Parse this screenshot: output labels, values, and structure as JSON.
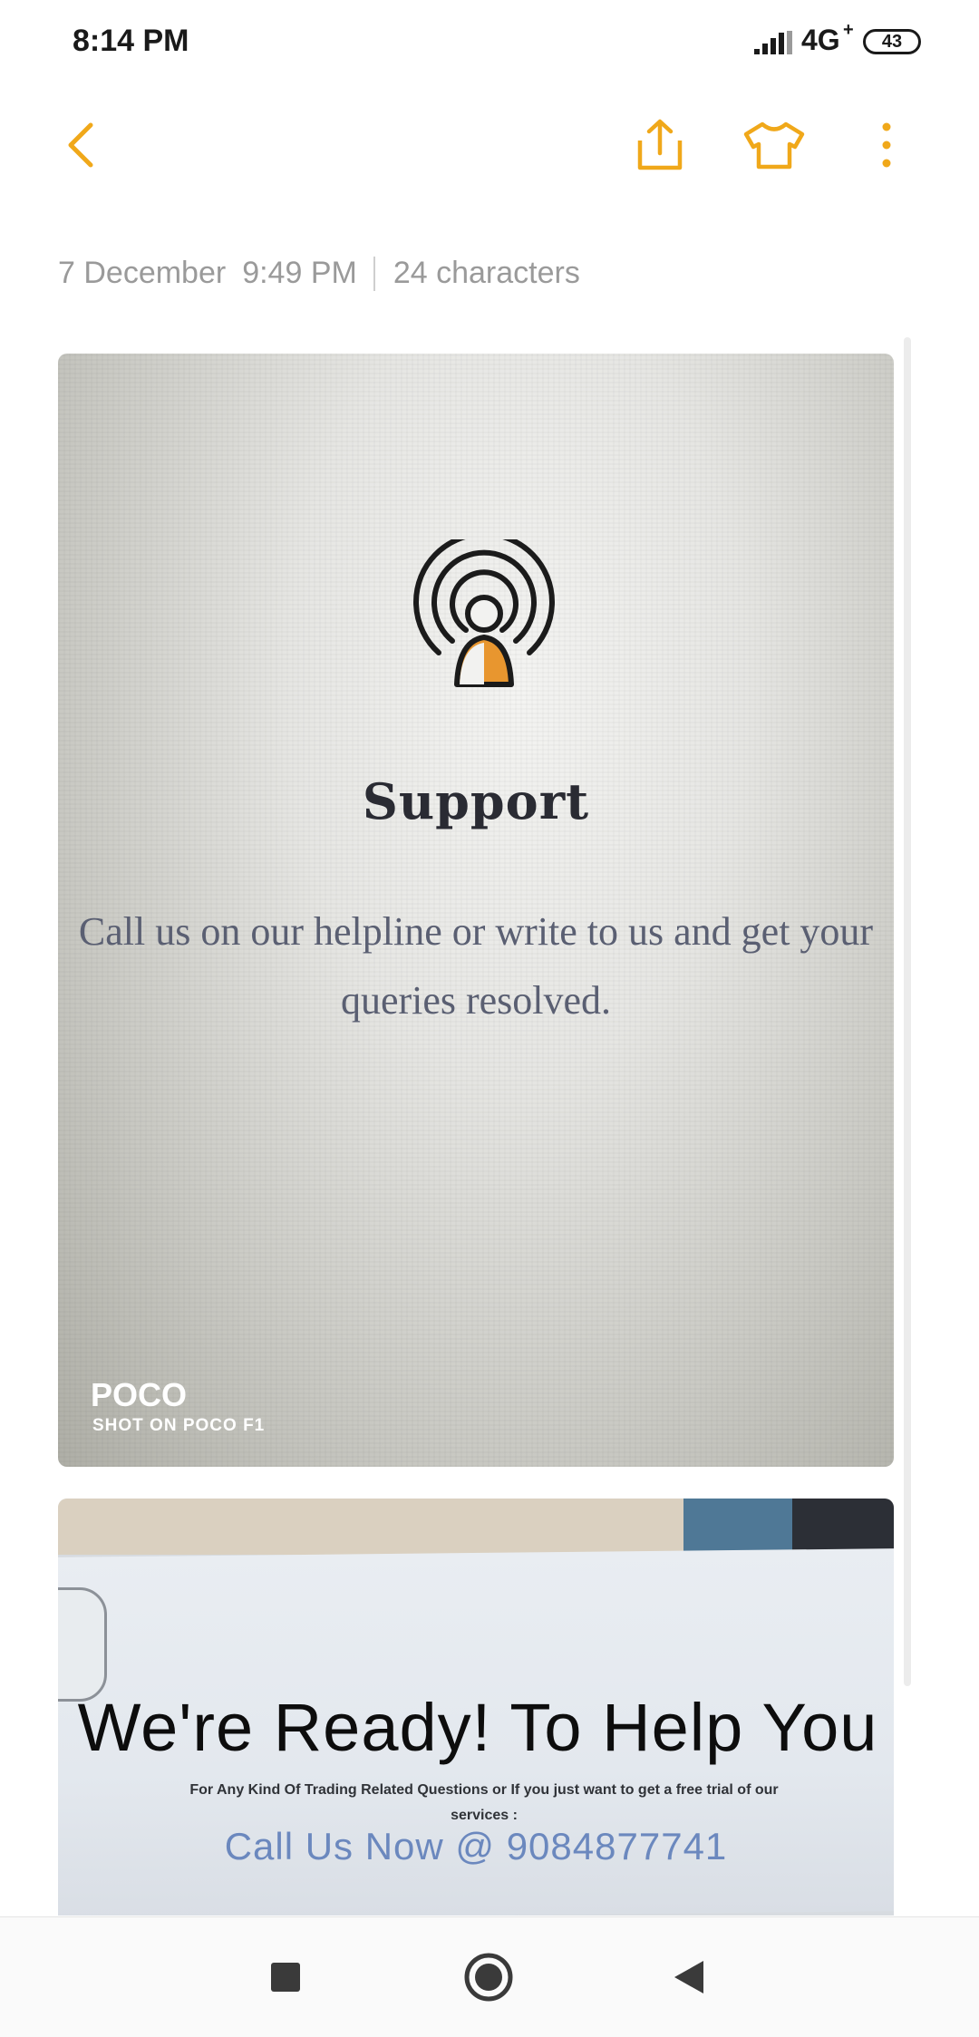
{
  "status_bar": {
    "time": "8:14 PM",
    "network": "4G",
    "network_plus": "+",
    "battery": "43",
    "icons": [
      "signal-icon",
      "battery-icon"
    ]
  },
  "toolbar": {
    "accent_color": "#F0A81A",
    "icons": [
      "back-icon",
      "share-icon",
      "theme-shirt-icon",
      "more-icon"
    ]
  },
  "note": {
    "date": "7 December",
    "time": "9:49 PM",
    "characters": "24 characters"
  },
  "attachments": [
    {
      "title": "Support",
      "text": "Call us on our helpline or write to us and get your queries resolved.",
      "watermark_brand": "POCO",
      "watermark_sub": "SHOT ON POCO F1",
      "icon": "support-broadcast-icon",
      "icon_accent": "#E8962F"
    },
    {
      "title": "We're Ready! To Help You",
      "subtitle": "For Any Kind Of Trading Related Questions or If you just want to get a free trial of our services :",
      "call": "Call Us Now @ 9084877741"
    }
  ],
  "nav_bar": {
    "icons": [
      "recents-square-icon",
      "home-circle-icon",
      "back-triangle-icon"
    ]
  }
}
